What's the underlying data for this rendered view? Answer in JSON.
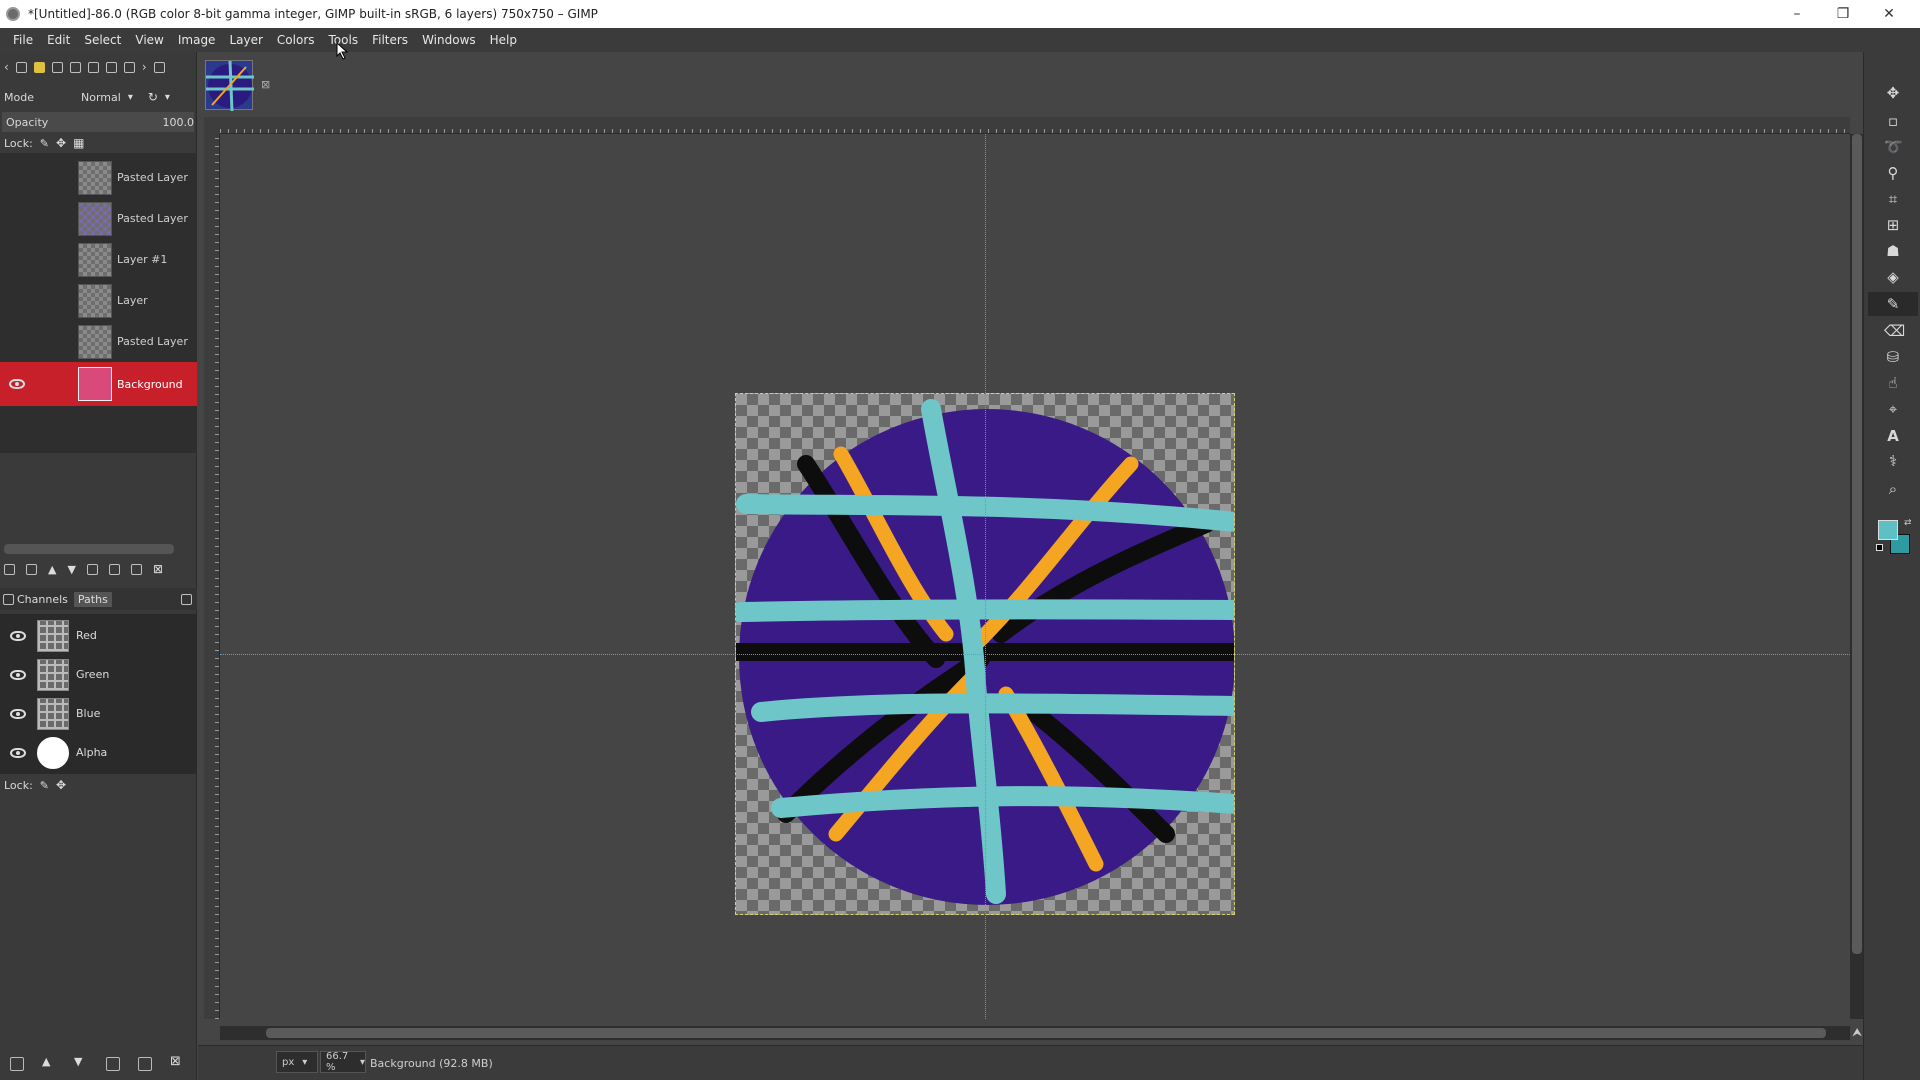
{
  "window": {
    "title": "*[Untitled]-86.0 (RGB color 8-bit gamma integer, GIMP built-in sRGB, 6 layers) 750x750 – GIMP",
    "minimize": "–",
    "restore": "❐",
    "close": "✕"
  },
  "menubar": [
    "File",
    "Edit",
    "Select",
    "View",
    "Image",
    "Layer",
    "Colors",
    "Tools",
    "Filters",
    "Windows",
    "Help"
  ],
  "layers_panel": {
    "mode_label": "Mode",
    "mode_value": "Normal",
    "opacity_label": "Opacity",
    "opacity_value": "100.0",
    "lock_label": "Lock:",
    "layers": [
      {
        "name": "Pasted Layer"
      },
      {
        "name": "Pasted Layer"
      },
      {
        "name": "Layer #1"
      },
      {
        "name": "Layer"
      },
      {
        "name": "Pasted Layer"
      },
      {
        "name": "Background",
        "active": true
      }
    ]
  },
  "channels_panel": {
    "tab_channels": "Channels",
    "tab_paths": "Paths",
    "channels": [
      {
        "name": "Red"
      },
      {
        "name": "Green"
      },
      {
        "name": "Blue"
      },
      {
        "name": "Alpha"
      }
    ],
    "lock_label": "Lock:"
  },
  "statusbar": {
    "unit": "px",
    "zoom": "66.7 %",
    "info": "Background (92.8 MB)"
  },
  "colors": {
    "fg": "#5ec0c4",
    "bg": "#2e9aa2",
    "ball": "#3a1a86",
    "stripe_teal": "#6ec6c9",
    "stripe_orange": "#f4a521",
    "stripe_black": "#0d0d0d",
    "active_layer": "#c8202a"
  },
  "icons": {
    "right_toolbox": [
      "move-icon",
      "rect-select-icon",
      "lasso-icon",
      "fuzzy-select-icon",
      "crop-icon",
      "unified-transform-icon",
      "warp-icon",
      "bucket-fill-icon",
      "paintbrush-icon",
      "eraser-icon",
      "clone-icon",
      "smudge-icon",
      "path-icon",
      "text-icon",
      "color-picker-icon",
      "zoom-icon"
    ]
  }
}
